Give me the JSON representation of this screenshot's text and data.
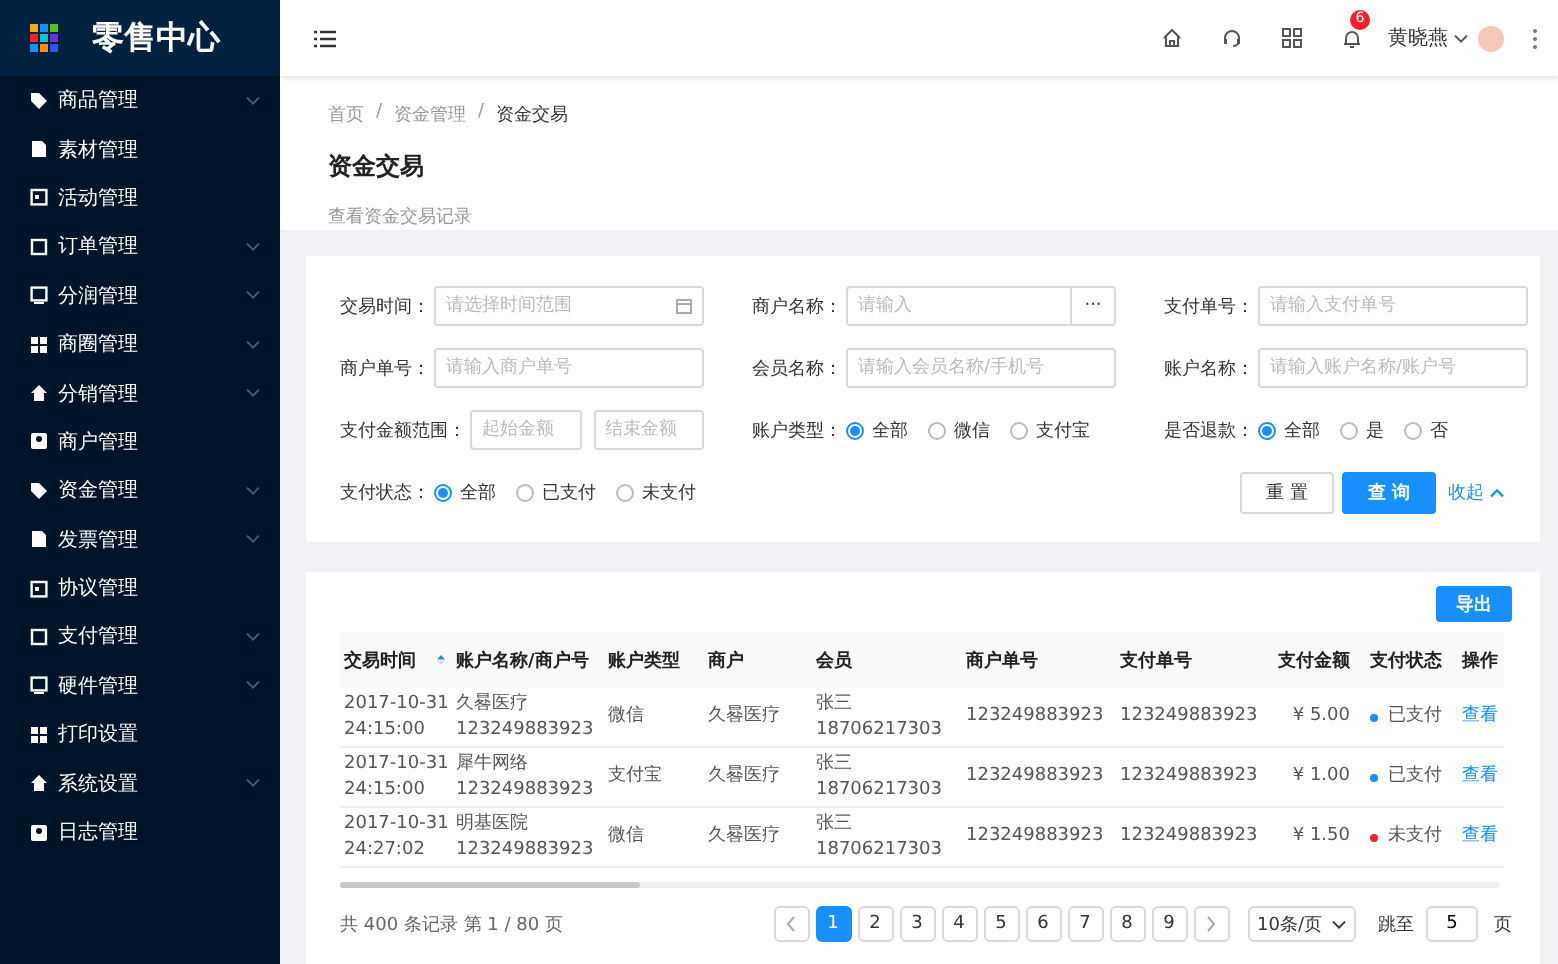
{
  "sidebar": {
    "title": "零售中心",
    "items": [
      {
        "label": "商品管理",
        "has_submenu": true
      },
      {
        "label": "素材管理",
        "has_submenu": false
      },
      {
        "label": "活动管理",
        "has_submenu": false
      },
      {
        "label": "订单管理",
        "has_submenu": true
      },
      {
        "label": "分润管理",
        "has_submenu": true
      },
      {
        "label": "商圈管理",
        "has_submenu": true
      },
      {
        "label": "分销管理",
        "has_submenu": true
      },
      {
        "label": "商户管理",
        "has_submenu": false
      },
      {
        "label": "资金管理",
        "has_submenu": true
      },
      {
        "label": "发票管理",
        "has_submenu": true
      },
      {
        "label": "协议管理",
        "has_submenu": false
      },
      {
        "label": "支付管理",
        "has_submenu": true
      },
      {
        "label": "硬件管理",
        "has_submenu": true
      },
      {
        "label": "打印设置",
        "has_submenu": false
      },
      {
        "label": "系统设置",
        "has_submenu": true
      },
      {
        "label": "日志管理",
        "has_submenu": false
      }
    ]
  },
  "header": {
    "notification_count": "6",
    "user_name": "黄晓燕"
  },
  "page_head": {
    "breadcrumb": [
      "首页",
      "资金管理",
      "资金交易"
    ],
    "separators": [
      "/",
      "/"
    ],
    "title": "资金交易",
    "subtitle": "查看资金交易记录"
  },
  "filters": {
    "fields": [
      {
        "kind": "date",
        "label": "交易时间：",
        "placeholder": "请选择时间范围"
      },
      {
        "kind": "picker",
        "label": "商户名称：",
        "placeholder": "请输入",
        "button": "···"
      },
      {
        "kind": "input",
        "label": "支付单号：",
        "placeholder": "请输入支付单号"
      },
      {
        "kind": "input",
        "label": "商户单号：",
        "placeholder": "请输入商户单号"
      },
      {
        "kind": "input",
        "label": "会员名称：",
        "placeholder": "请输入会员名称/手机号"
      },
      {
        "kind": "input",
        "label": "账户名称：",
        "placeholder": "请输入账户名称/账户号"
      },
      {
        "kind": "range",
        "label": "支付金额范围：",
        "placeholders": [
          "起始金额",
          "结束金额"
        ]
      },
      {
        "kind": "radio",
        "label": "账户类型：",
        "options": [
          {
            "label": "全部",
            "selected": true
          },
          {
            "label": "微信",
            "selected": false
          },
          {
            "label": "支付宝",
            "selected": false
          }
        ]
      },
      {
        "kind": "radio",
        "label": "是否退款：",
        "options": [
          {
            "label": "全部",
            "selected": true
          },
          {
            "label": "是",
            "selected": false
          },
          {
            "label": "否",
            "selected": false
          }
        ]
      },
      {
        "kind": "radio",
        "label": "支付状态：",
        "options": [
          {
            "label": "全部",
            "selected": true
          },
          {
            "label": "已支付",
            "selected": false
          },
          {
            "label": "未支付",
            "selected": false
          }
        ]
      }
    ],
    "reset_button": "重 置",
    "query_button": "查 询",
    "collapse_link": "收起"
  },
  "table": {
    "export_button": "导出",
    "columns": [
      {
        "label": "交易时间",
        "sortable": true
      },
      {
        "label": "账户名称/商户号",
        "sortable": false
      },
      {
        "label": "账户类型",
        "sortable": false
      },
      {
        "label": "商户",
        "sortable": false
      },
      {
        "label": "会员",
        "sortable": false
      },
      {
        "label": "商户单号",
        "sortable": false
      },
      {
        "label": "支付单号",
        "sortable": false
      },
      {
        "label": "支付金额",
        "sortable": false
      },
      {
        "label": "支付状态",
        "sortable": false
      },
      {
        "label": "操作",
        "sortable": false
      }
    ],
    "rows": [
      {
        "time": [
          "2017-10-31",
          "24:15:00"
        ],
        "account": [
          "久晷医疗",
          "123249883923"
        ],
        "account_type": "微信",
        "merchant": "久晷医疗",
        "member": [
          "张三",
          "18706217303"
        ],
        "merchant_order": "123249883923",
        "payment_order": "123249883923",
        "amount": "¥ 5.00",
        "status": {
          "text": "已支付",
          "color": "#1890ff"
        },
        "action": "查看"
      },
      {
        "time": [
          "2017-10-31",
          "24:15:00"
        ],
        "account": [
          "犀牛网络",
          "123249883923"
        ],
        "account_type": "支付宝",
        "merchant": "久晷医疗",
        "member": [
          "张三",
          "18706217303"
        ],
        "merchant_order": "123249883923",
        "payment_order": "123249883923",
        "amount": "¥ 1.00",
        "status": {
          "text": "已支付",
          "color": "#1890ff"
        },
        "action": "查看"
      },
      {
        "time": [
          "2017-10-31",
          "24:27:02"
        ],
        "account": [
          "明基医院",
          "123249883923"
        ],
        "account_type": "微信",
        "merchant": "久晷医疗",
        "member": [
          "张三",
          "18706217303"
        ],
        "merchant_order": "123249883923",
        "payment_order": "123249883923",
        "amount": "¥ 1.50",
        "status": {
          "text": "未支付",
          "color": "#f5222d"
        },
        "action": "查看"
      }
    ]
  },
  "pagination": {
    "summary": "共 400 条记录 第 1 / 80 页",
    "pages": [
      {
        "label": "1",
        "selected": true
      },
      {
        "label": "2",
        "selected": false
      },
      {
        "label": "3",
        "selected": false
      },
      {
        "label": "4",
        "selected": false
      },
      {
        "label": "5",
        "selected": false
      },
      {
        "label": "6",
        "selected": false
      },
      {
        "label": "7",
        "selected": false
      },
      {
        "label": "8",
        "selected": false
      },
      {
        "label": "9",
        "selected": false
      }
    ],
    "page_size": "10条/页",
    "jump_label": "跳至",
    "jump_value": "5",
    "jump_suffix": "页"
  }
}
